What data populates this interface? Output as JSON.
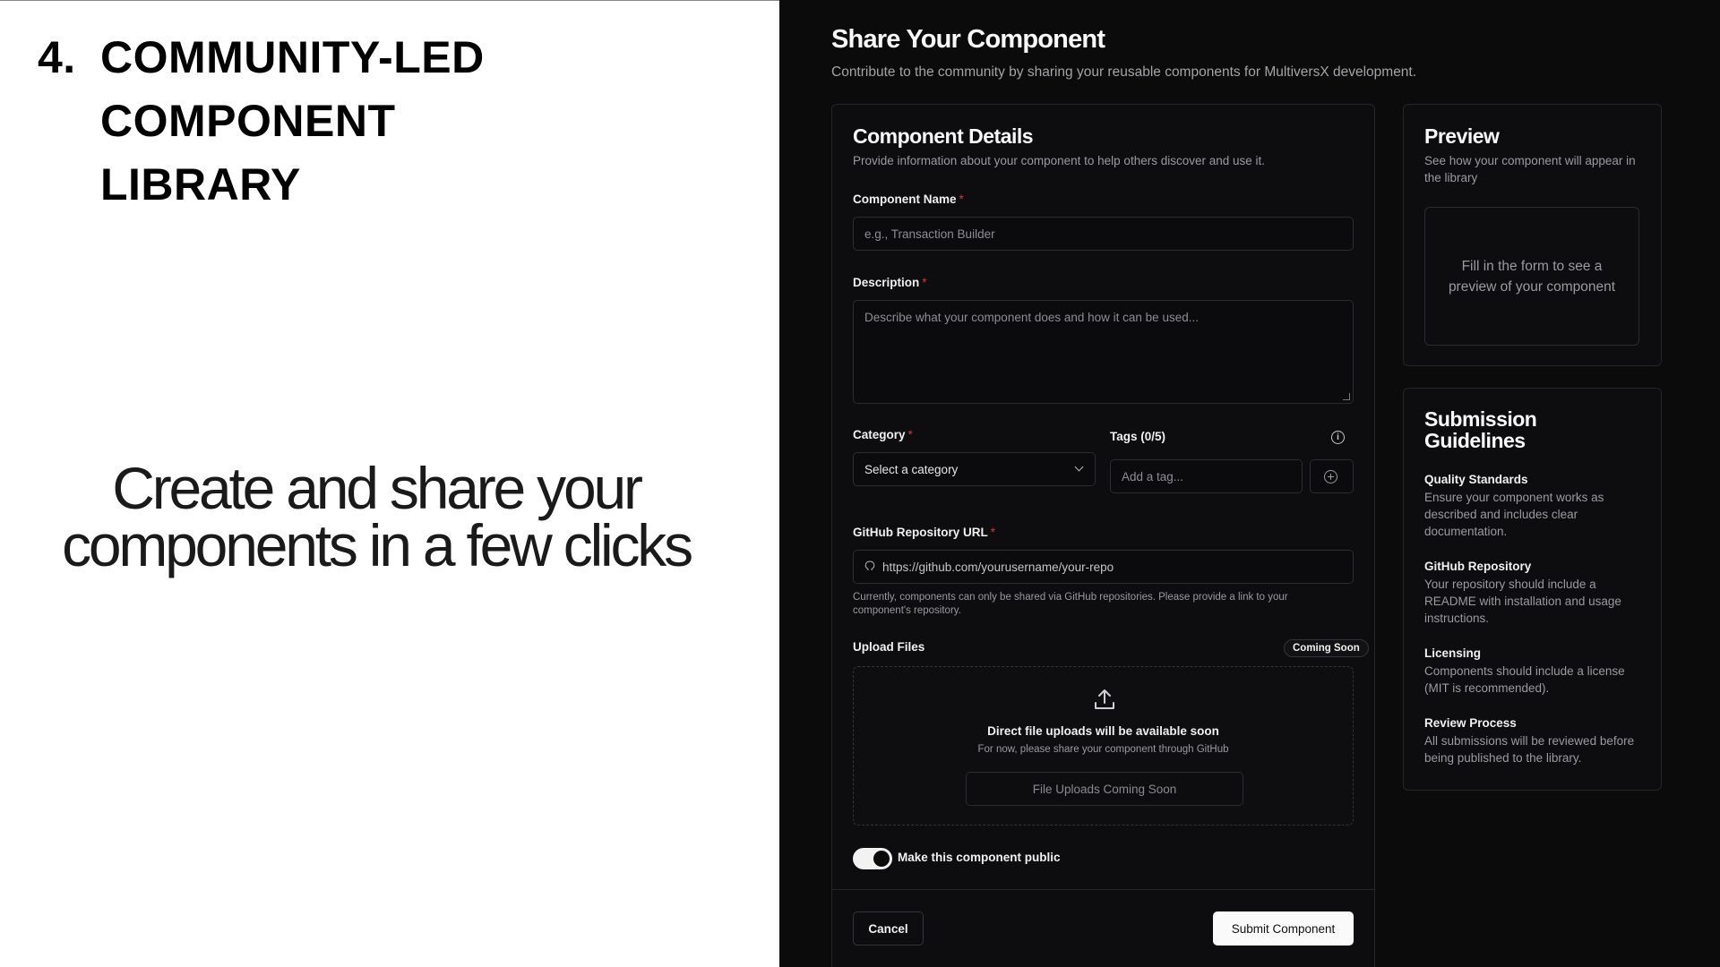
{
  "slide": {
    "heading_num": "4.",
    "heading_lines": [
      "COMMUNITY-LED",
      "COMPONENT",
      "LIBRARY"
    ],
    "tagline_lines": [
      "Create and share your",
      "components in a few clicks"
    ]
  },
  "page": {
    "title": "Share Your Component",
    "subtitle": "Contribute to the community by sharing your reusable components for MultiversX development."
  },
  "details": {
    "title": "Component Details",
    "desc": "Provide information about your component to help others discover and use it.",
    "name_label": "Component Name",
    "name_placeholder": "e.g., Transaction Builder",
    "description_label": "Description",
    "description_placeholder": "Describe what your component does and how it can be used...",
    "category_label": "Category",
    "category_value": "Select a category",
    "tags_label": "Tags (0/5)",
    "tags_placeholder": "Add a tag...",
    "github_label": "GitHub Repository URL",
    "github_placeholder": "https://github.com/yourusername/your-repo",
    "github_help": "Currently, components can only be shared via GitHub repositories. Please provide a link to your component's repository.",
    "upload_label": "Upload Files",
    "upload_badge": "Coming Soon",
    "upload_title": "Direct file uploads will be available soon",
    "upload_sub": "For now, please share your component through GitHub",
    "upload_button": "File Uploads Coming Soon",
    "public_label": "Make this component public",
    "public_on": true,
    "cancel": "Cancel",
    "submit": "Submit Component",
    "required_mark": "*"
  },
  "preview": {
    "title": "Preview",
    "desc": "See how your component will appear in the library",
    "empty": "Fill in the form to see a preview of your component"
  },
  "guidelines": {
    "title": "Submission Guidelines",
    "items": [
      {
        "title": "Quality Standards",
        "text": "Ensure your component works as described and includes clear documentation."
      },
      {
        "title": "GitHub Repository",
        "text": "Your repository should include a README with installation and usage instructions."
      },
      {
        "title": "Licensing",
        "text": "Components should include a license (MIT is recommended)."
      },
      {
        "title": "Review Process",
        "text": "All submissions will be reviewed before being published to the library."
      }
    ]
  },
  "icons": {
    "select": "chevron-down-icon",
    "tags_info": "info-icon",
    "add_tag": "plus-circle-icon",
    "github": "github-icon",
    "upload": "upload-icon"
  }
}
